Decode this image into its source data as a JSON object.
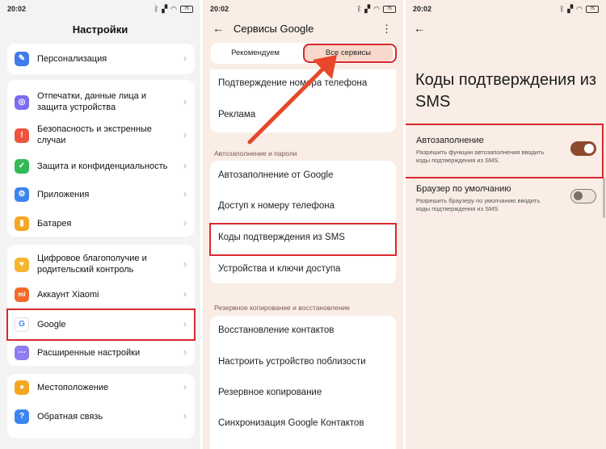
{
  "status": {
    "time": "20:02",
    "battery": "75"
  },
  "panel1": {
    "title": "Настройки",
    "items": [
      {
        "label": "Персонализация",
        "icon": "brush-icon",
        "color": "#3f7bea"
      },
      {
        "label": "Отпечатки, данные лица и защита устройства",
        "icon": "fingerprint-icon",
        "color": "#7b6cf0"
      },
      {
        "label": "Безопасность и экстренные случаи",
        "icon": "emergency-icon",
        "color": "#f0533e"
      },
      {
        "label": "Защита и конфиденциальность",
        "icon": "shield-icon",
        "color": "#34b955"
      },
      {
        "label": "Приложения",
        "icon": "apps-icon",
        "color": "#3d84f0"
      },
      {
        "label": "Батарея",
        "icon": "battery-icon",
        "color": "#f5a623"
      },
      {
        "label": "Цифровое благополучие и родительский контроль",
        "icon": "wellbeing-icon",
        "color": "#f5b731"
      },
      {
        "label": "Аккаунт Xiaomi",
        "icon": "xiaomi-icon",
        "color": "#f36a2b"
      },
      {
        "label": "Google",
        "icon": "google-icon",
        "color": "#ffffff"
      },
      {
        "label": "Расширенные настройки",
        "icon": "more-icon",
        "color": "#8e7cf0"
      },
      {
        "label": "Местоположение",
        "icon": "location-icon",
        "color": "#f5a623"
      },
      {
        "label": "Обратная связь",
        "icon": "feedback-icon",
        "color": "#3d84f0"
      }
    ]
  },
  "panel2": {
    "title": "Сервисы Google",
    "tabs": [
      "Рекомендуем",
      "Все сервисы"
    ],
    "group1": [
      "Подтверждение номера телефона",
      "Реклама"
    ],
    "section1": "Автозаполнение и пароли",
    "group2": [
      "Автозаполнение от Google",
      "Доступ к номеру телефона",
      "Коды подтверждения из SMS",
      "Устройства и ключи доступа"
    ],
    "section2": "Резервное копирование и восстановление",
    "group3": [
      "Восстановление контактов",
      "Настроить устройство поблизости",
      "Резервное копирование",
      "Синхронизация Google Контактов"
    ]
  },
  "panel3": {
    "title": "Коды подтверждения из SMS",
    "options": [
      {
        "title": "Автозаполнение",
        "subtitle": "Разрешить функции автозаполнения вводить коды подтверждения из SMS.",
        "enabled": true
      },
      {
        "title": "Браузер по умолчанию",
        "subtitle": "Разрешить браузеру по умолчанию вводить коды подтверждения из SMS",
        "enabled": false
      }
    ]
  },
  "colors": {
    "highlight": "#d9282f",
    "accent": "#8c4b2e",
    "arrow": "#e8472b"
  }
}
